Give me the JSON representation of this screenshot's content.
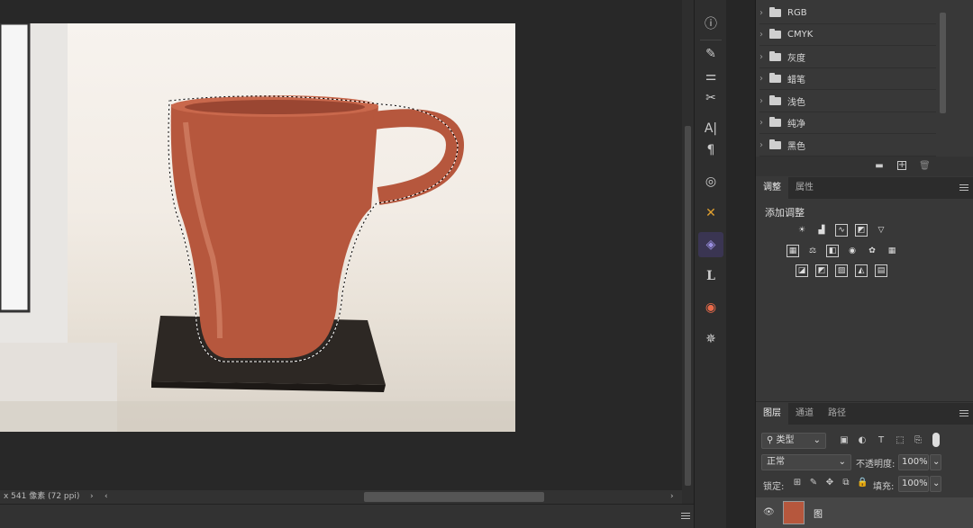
{
  "status": {
    "text": "x 541 像素 (72 ppi)",
    "arrow": "›"
  },
  "tools": [
    {
      "name": "info-icon",
      "glyph": "ⓘ"
    },
    {
      "name": "brush-settings-icon",
      "glyph": "✎"
    },
    {
      "name": "adjust-sliders-icon",
      "glyph": "⚌"
    },
    {
      "name": "tools-icon",
      "glyph": "✂"
    },
    {
      "name": "character-icon",
      "glyph": "A|"
    },
    {
      "name": "paragraph-icon",
      "glyph": "¶"
    },
    {
      "name": "clone-source-icon",
      "glyph": "◎"
    },
    {
      "name": "plugin-icon",
      "glyph": "✕"
    },
    {
      "name": "eraser-icon",
      "glyph": "◈"
    },
    {
      "name": "libraries-icon",
      "glyph": "L"
    },
    {
      "name": "camera-icon",
      "glyph": "◉"
    },
    {
      "name": "ship-wheel-icon",
      "glyph": "✵"
    }
  ],
  "swatches": {
    "groups": [
      "RGB",
      "CMYK",
      "灰度",
      "蜡笔",
      "浅色",
      "纯净",
      "黑色"
    ],
    "footer_icons": [
      "folder-icon",
      "new-icon",
      "trash-icon"
    ]
  },
  "adjustments": {
    "tabs": [
      "调整",
      "属性"
    ],
    "heading": "添加调整"
  },
  "layers": {
    "tabs": [
      "图层",
      "通道",
      "路径"
    ],
    "filter_label": "类型",
    "blend_mode": "正常",
    "opacity_label": "不透明度:",
    "opacity_value": "100%",
    "lock_label": "锁定:",
    "fill_label": "填充:",
    "fill_value": "100%",
    "layer_name": "图"
  },
  "colors": {
    "panel": "#383838",
    "canvas_bg": "#282828",
    "mug": "#b6573d"
  }
}
